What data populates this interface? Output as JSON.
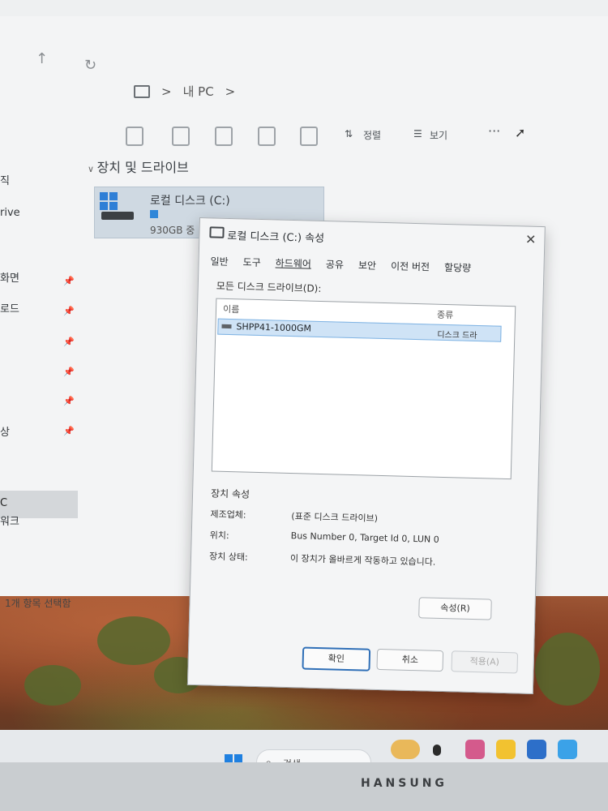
{
  "explorer": {
    "breadcrumb": {
      "location": "내 PC",
      "sep1": ">",
      "sep2": ">"
    },
    "toolbar": {
      "sort_label": "정렬",
      "view_label": "보기",
      "more_label": "···"
    },
    "section_title": "장치 및 드라이브",
    "drive": {
      "label": "로컬 디스크 (C:)",
      "size_text": "930GB 중"
    },
    "nav_items": [
      "직",
      "rive",
      "화면",
      "로드",
      "상",
      "C",
      "워크"
    ],
    "status_text": "1개 항목 선택함"
  },
  "dialog": {
    "title": "로컬 디스크 (C:) 속성",
    "close": "✕",
    "tabs": [
      "일반",
      "도구",
      "하드웨어",
      "공유",
      "보안",
      "이전 버전",
      "할당량"
    ],
    "list_label": "모든 디스크 드라이브(D):",
    "columns": [
      "이름",
      "종류"
    ],
    "disk": {
      "name": "SHPP41-1000GM",
      "type": "디스크 드라"
    },
    "props_title": "장치 속성",
    "props": [
      {
        "key": "제조업체:",
        "value": "(표준 디스크 드라이브)"
      },
      {
        "key": "위치:",
        "value": "Bus Number 0, Target Id 0, LUN 0"
      },
      {
        "key": "장치 상태:",
        "value": "이 장치가 올바르게 작동하고 있습니다."
      }
    ],
    "properties_button": "속성(R)",
    "ok_button": "확인",
    "cancel_button": "취소",
    "apply_button": "적용(A)"
  },
  "taskbar": {
    "search_label": "검색"
  },
  "monitor": {
    "brand": "HANSUNG"
  }
}
